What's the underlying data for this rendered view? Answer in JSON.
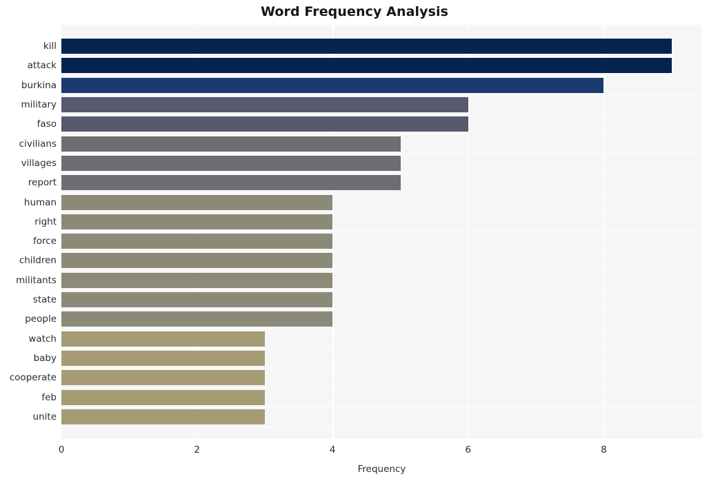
{
  "chart_data": {
    "type": "bar",
    "orientation": "horizontal",
    "title": "Word Frequency Analysis",
    "xlabel": "Frequency",
    "ylabel": "",
    "xlim": [
      0,
      9.45
    ],
    "xticks": [
      0,
      2,
      4,
      6,
      8
    ],
    "xtick_labels": [
      "0",
      "2",
      "4",
      "6",
      "8"
    ],
    "grid": true,
    "legend": null,
    "categories": [
      "kill",
      "attack",
      "burkina",
      "military",
      "faso",
      "civilians",
      "villages",
      "report",
      "human",
      "right",
      "force",
      "children",
      "militants",
      "state",
      "people",
      "watch",
      "baby",
      "cooperate",
      "feb",
      "unite"
    ],
    "values": [
      9,
      9,
      8,
      6,
      6,
      5,
      5,
      5,
      4,
      4,
      4,
      4,
      4,
      4,
      4,
      3,
      3,
      3,
      3,
      3
    ],
    "bar_colors": [
      "#04234f",
      "#04234f",
      "#1a3a70",
      "#565a6d",
      "#565a6d",
      "#6e6e72",
      "#6e6e72",
      "#6e6e72",
      "#8b8a79",
      "#8b8a79",
      "#8b8a79",
      "#8b8a79",
      "#8b8a79",
      "#8b8a79",
      "#8b8a79",
      "#a69c73",
      "#a69c73",
      "#a69c73",
      "#a69c73",
      "#a69c73"
    ],
    "plot_background": "#f6f6f7",
    "gridline_color": "#ffffff",
    "figure_background": "#ffffff"
  }
}
